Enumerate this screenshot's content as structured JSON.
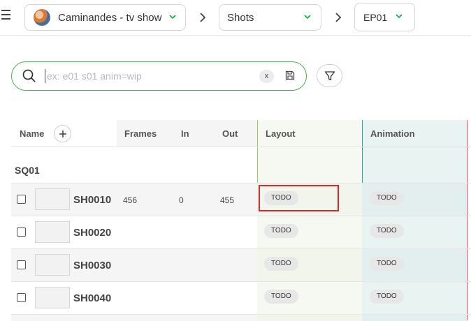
{
  "breadcrumb": {
    "production_label": "Caminandes - tv show",
    "view_label": "Shots",
    "episode_label": "EP01"
  },
  "icons": {
    "menu": "hamburger-menu-icon",
    "separator": "chevron-right-icon",
    "dropdown": "chevron-down-icon",
    "search": "search-icon",
    "clear": "clear-x-icon",
    "save": "save-floppy-icon",
    "filter": "filter-funnel-icon",
    "add": "plus-icon"
  },
  "colors": {
    "accent": "#00b242",
    "search_border": "#4caf50",
    "layout_column": "#f1f5ec",
    "animation_column": "#e3efee",
    "selection_outline": "#d62b2b"
  },
  "search": {
    "placeholder": "ex: e01 s01 anim=wip",
    "value": "",
    "clear_label": "x"
  },
  "table": {
    "columns": {
      "name": "Name",
      "frames": "Frames",
      "in": "In",
      "out": "Out",
      "layout": "Layout",
      "animation": "Animation"
    },
    "sequence": "SQ01",
    "rows": [
      {
        "name": "SH0010",
        "frames": "456",
        "in": "0",
        "out": "455",
        "layout": "TODO",
        "animation": "TODO"
      },
      {
        "name": "SH0020",
        "frames": "",
        "in": "",
        "out": "",
        "layout": "TODO",
        "animation": "TODO"
      },
      {
        "name": "SH0030",
        "frames": "",
        "in": "",
        "out": "",
        "layout": "TODO",
        "animation": "TODO"
      },
      {
        "name": "SH0040",
        "frames": "",
        "in": "",
        "out": "",
        "layout": "TODO",
        "animation": "TODO"
      }
    ]
  }
}
